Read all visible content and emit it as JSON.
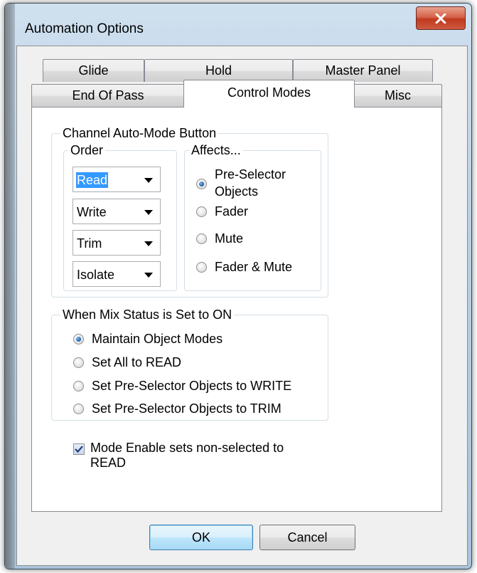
{
  "window": {
    "title": "Automation Options",
    "close_icon": "close-icon"
  },
  "tabs_row1": [
    {
      "label": "Glide"
    },
    {
      "label": "Hold"
    },
    {
      "label": "Master Panel"
    }
  ],
  "tabs_row2": [
    {
      "label": "End Of Pass"
    },
    {
      "label": "Control Modes",
      "active": true
    },
    {
      "label": "Misc"
    }
  ],
  "channel_group": {
    "legend": "Channel Auto-Mode Button",
    "order": {
      "legend": "Order",
      "combos": [
        {
          "value": "Read"
        },
        {
          "value": "Write"
        },
        {
          "value": "Trim"
        },
        {
          "value": "Isolate"
        }
      ]
    },
    "affects": {
      "legend": "Affects...",
      "options": [
        {
          "label_line1": "Pre-Selector",
          "label_line2": "Objects",
          "checked": true
        },
        {
          "label": "Fader",
          "checked": false
        },
        {
          "label": "Mute",
          "checked": false
        },
        {
          "label": "Fader & Mute",
          "checked": false
        }
      ]
    }
  },
  "mix_group": {
    "legend": "When Mix Status is Set to ON",
    "options": [
      {
        "label": "Maintain Object Modes",
        "checked": true
      },
      {
        "label": "Set All to READ",
        "checked": false
      },
      {
        "label": "Set Pre-Selector Objects to WRITE",
        "checked": false
      },
      {
        "label": "Set Pre-Selector Objects to TRIM",
        "checked": false
      }
    ]
  },
  "mode_enable": {
    "label_line1": "Mode Enable sets non-selected to",
    "label_line2": "READ",
    "checked": true
  },
  "buttons": {
    "ok": "OK",
    "cancel": "Cancel"
  }
}
